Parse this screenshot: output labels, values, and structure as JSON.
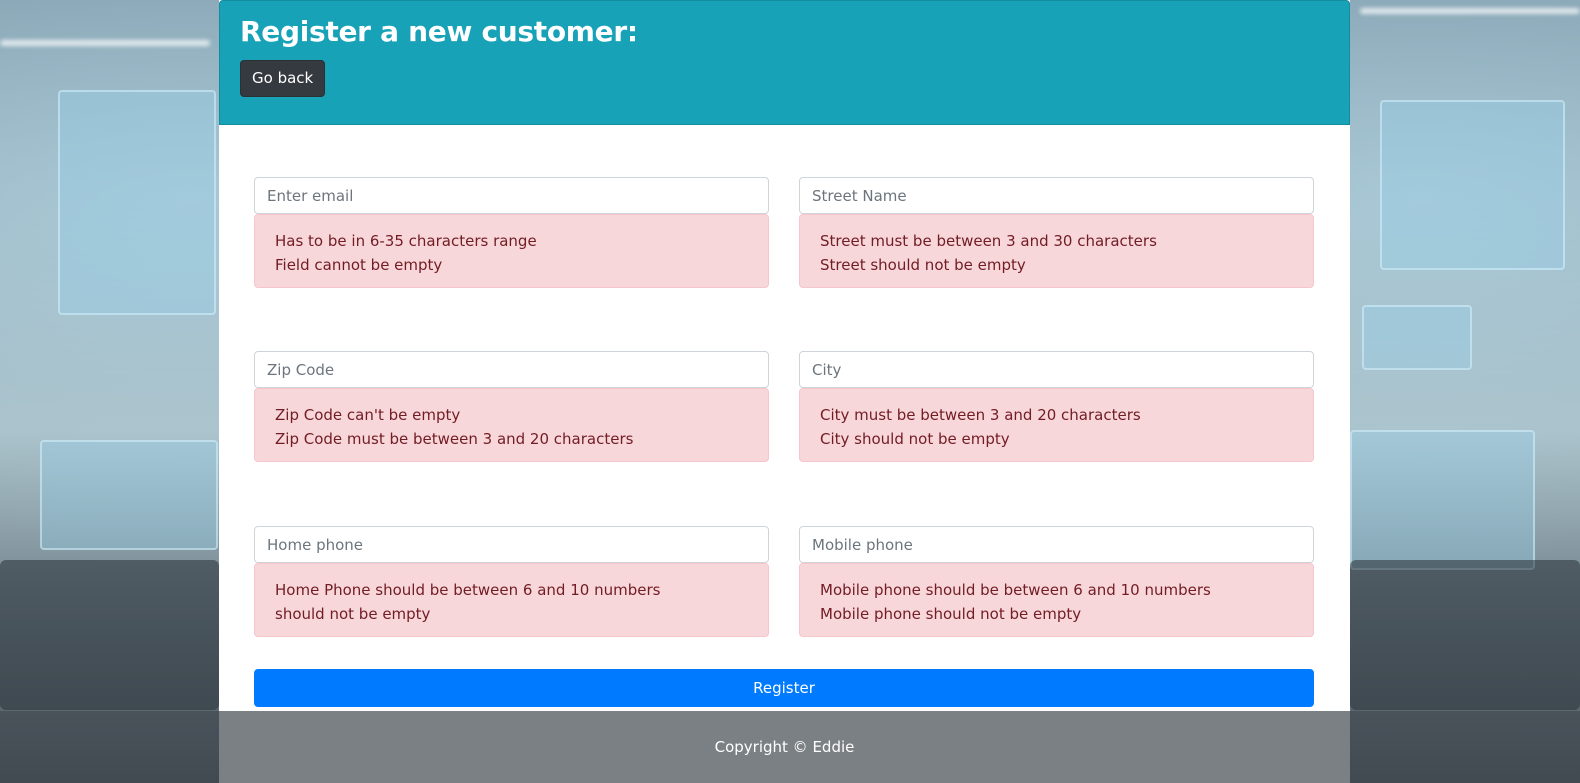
{
  "header": {
    "title": "Register a new customer:",
    "back_label": "Go back"
  },
  "form": {
    "email": {
      "placeholder": "Enter email",
      "errors": [
        "Has to be in 6-35 characters range",
        "Field cannot be empty"
      ]
    },
    "street": {
      "placeholder": "Street Name",
      "errors": [
        "Street must be between 3 and 30 characters",
        "Street should not be empty"
      ]
    },
    "zip": {
      "placeholder": "Zip Code",
      "errors": [
        "Zip Code can't be empty",
        "Zip Code must be between 3 and 20 characters"
      ]
    },
    "city": {
      "placeholder": "City",
      "errors": [
        "City must be between 3 and 20 characters",
        "City should not be empty"
      ]
    },
    "home_phone": {
      "placeholder": "Home phone",
      "errors": [
        "Home Phone should be between 6 and 10 numbers",
        "should not be empty"
      ]
    },
    "mobile_phone": {
      "placeholder": "Mobile phone",
      "errors": [
        "Mobile phone should be between 6 and 10 numbers",
        "Mobile phone should not be empty"
      ]
    },
    "submit_label": "Register"
  },
  "footer": {
    "copyright": "Copyright © Eddie"
  },
  "colors": {
    "header": "#17a2b8",
    "primary": "#007bff",
    "dark_button": "#343a40",
    "alert_bg": "#f8d7da",
    "alert_text": "#721c24"
  }
}
